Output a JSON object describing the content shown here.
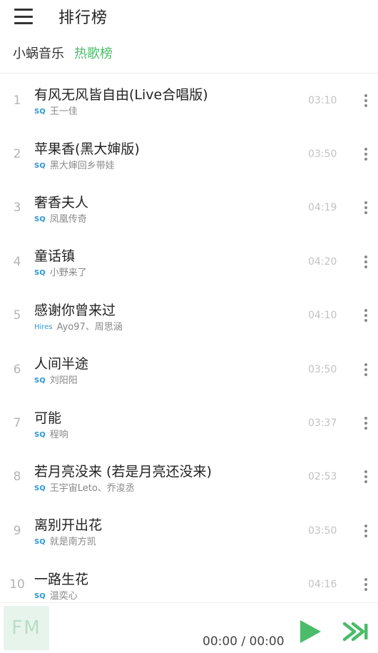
{
  "header": {
    "title": "排行榜",
    "menu_icon": "menu-icon"
  },
  "crumbs": {
    "source": "小蜗音乐",
    "current": "热歌榜"
  },
  "colors": {
    "accent": "#4cbb6a",
    "badge": "#2e96d8"
  },
  "songs": [
    {
      "index": "1",
      "title": "有风无风皆自由(Live合唱版)",
      "badge": "SQ",
      "artist": "王一佳",
      "duration": "03:10"
    },
    {
      "index": "2",
      "title": "苹果香(黑大婶版)",
      "badge": "SQ",
      "artist": "黑大婶回乡带娃",
      "duration": "03:50"
    },
    {
      "index": "3",
      "title": "奢香夫人",
      "badge": "SQ",
      "artist": "凤凰传奇",
      "duration": "04:19"
    },
    {
      "index": "4",
      "title": "童话镇",
      "badge": "SQ",
      "artist": "小野来了",
      "duration": "04:20"
    },
    {
      "index": "5",
      "title": "感谢你曾来过",
      "badge": "Hires",
      "artist": "Ayo97、周思涵",
      "duration": "04:10"
    },
    {
      "index": "6",
      "title": "人间半途",
      "badge": "SQ",
      "artist": "刘阳阳",
      "duration": "03:50"
    },
    {
      "index": "7",
      "title": "可能",
      "badge": "SQ",
      "artist": "程响",
      "duration": "03:37"
    },
    {
      "index": "8",
      "title": "若月亮没来 (若是月亮还没来)",
      "badge": "SQ",
      "artist": "王宇宙Leto、乔浚丞",
      "duration": "02:53"
    },
    {
      "index": "9",
      "title": "离别开出花",
      "badge": "SQ",
      "artist": "就是南方凯",
      "duration": "03:50"
    },
    {
      "index": "10",
      "title": "一路生花",
      "badge": "SQ",
      "artist": "温奕心",
      "duration": "04:16"
    }
  ],
  "player": {
    "cover_text": "FM",
    "time": "00:00 / 00:00"
  }
}
